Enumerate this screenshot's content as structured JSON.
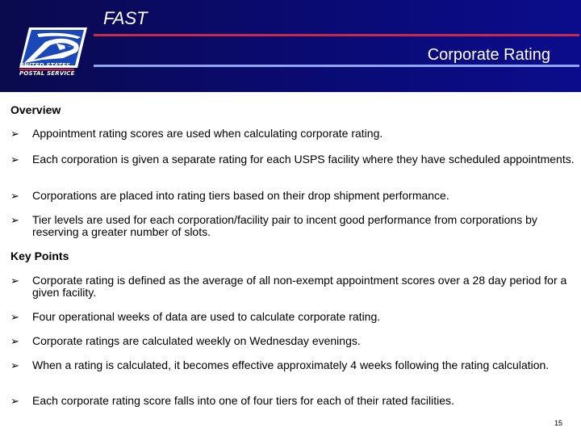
{
  "header": {
    "app_title": "FAST",
    "page_title": "Corporate Rating",
    "logo": {
      "line1": "UNITED STATES",
      "line2": "POSTAL SERVICE",
      "icon": "usps-eagle-icon"
    },
    "colors": {
      "background_left": "#0a0a4e",
      "background_right": "#0b0c8c",
      "red_rule": "#c8284a",
      "blue_rule": "#8fa6f0"
    }
  },
  "sections": [
    {
      "heading": "Overview",
      "bullets": [
        "Appointment rating scores are used when calculating corporate rating.",
        "Each corporation is given a separate rating for each USPS facility where they have scheduled appointments.",
        "Corporations are placed into rating tiers based on their drop shipment performance.",
        "Tier levels are used for each corporation/facility pair to incent good performance from corporations by reserving a greater number of slots."
      ]
    },
    {
      "heading": "Key Points",
      "bullets": [
        "Corporate rating is defined as the average of all non-exempt appointment scores over a 28 day period for a given facility.",
        "Four operational weeks of data are used to calculate corporate rating.",
        "Corporate ratings are calculated weekly on Wednesday evenings.",
        "When a rating is calculated, it becomes effective approximately 4 weeks following the rating calculation.",
        "Each corporate rating score falls into one of four tiers for each of their rated facilities."
      ]
    }
  ],
  "bullet_icon": "arrow-bullet-icon",
  "bullet_glyph": "➢",
  "page_number": "15"
}
